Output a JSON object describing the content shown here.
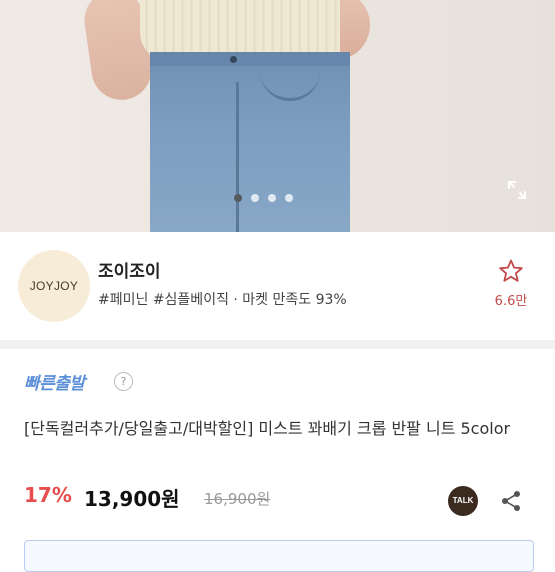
{
  "gallery": {
    "slide_count": 4,
    "active_index": 0
  },
  "shop": {
    "logo_text": "JOYJOY",
    "name": "조이조이",
    "tags": "#페미닌 #심플베이직 · 마켓 만족도 93%",
    "favorite_count": "6.6만"
  },
  "shipping": {
    "fast_label": "빠른출발",
    "help_glyph": "?"
  },
  "product": {
    "title": "[단독컬러추가/당일출고/대박할인] 미스트 꽈배기 크롭 반팔 니트 5color",
    "discount": "17%",
    "price": "13,900원",
    "original_price": "16,900원"
  },
  "actions": {
    "talk_label": "TALK"
  },
  "colors": {
    "discount": "#e84d4d",
    "fast_shipping": "#5d90d8",
    "favorite": "#c24a4a"
  }
}
